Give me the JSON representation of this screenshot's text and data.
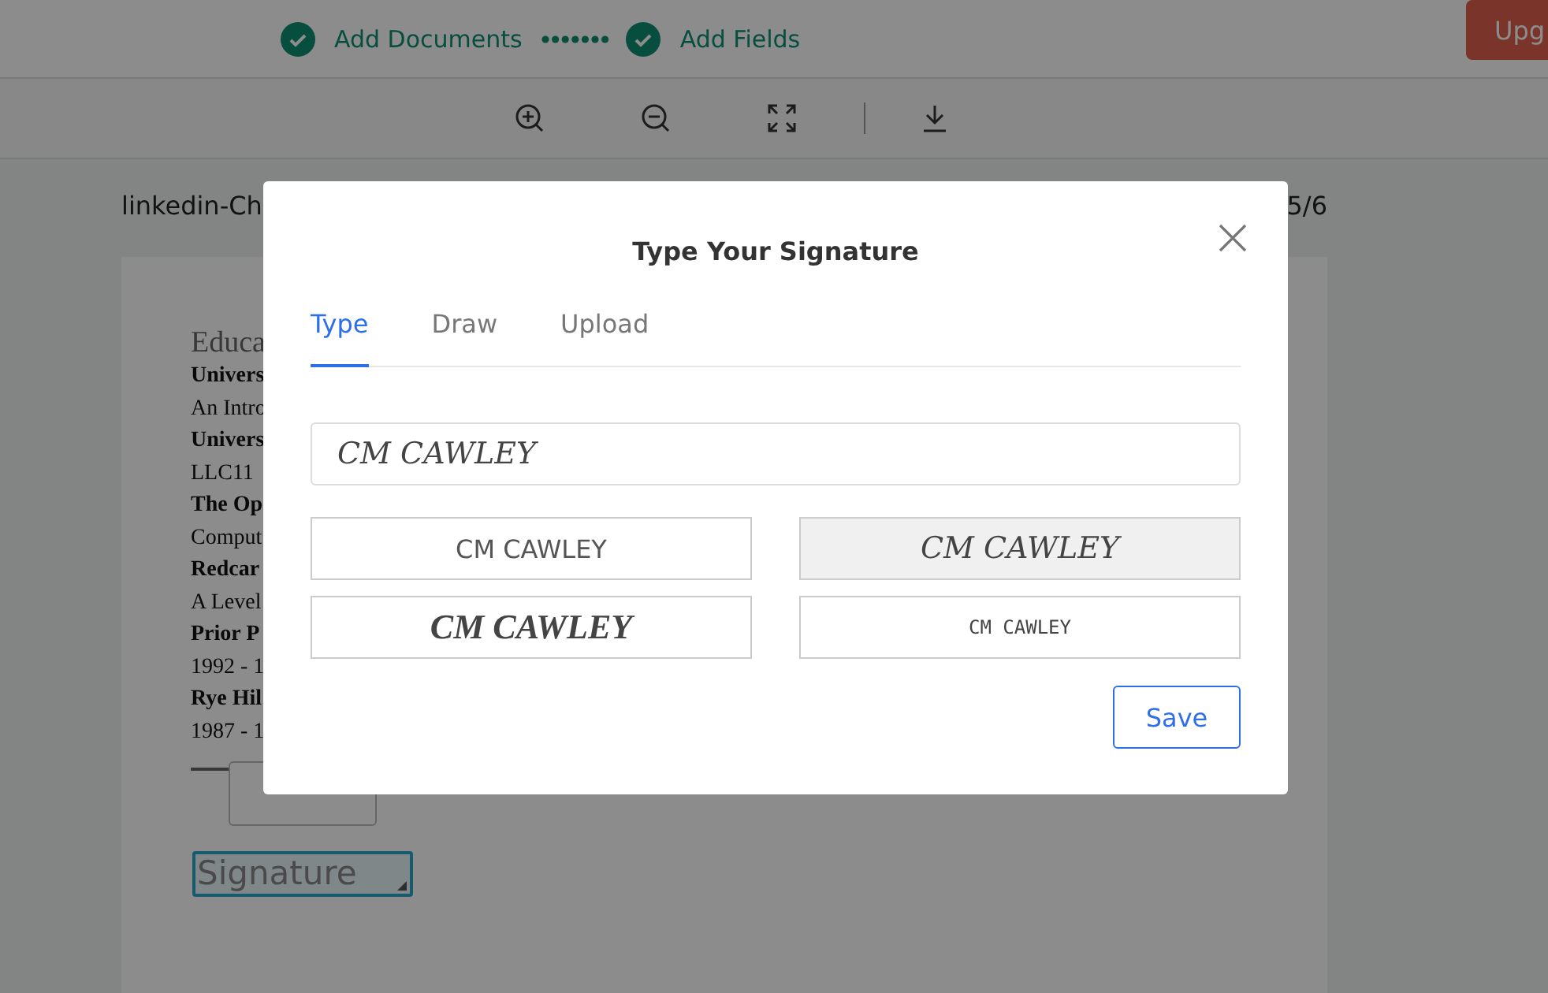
{
  "steps": [
    {
      "label": "Add Documents",
      "done": true
    },
    {
      "label": "Add Fields",
      "done": true
    }
  ],
  "upgrade_button": "Upg",
  "toolbar": [
    {
      "kind": "zoom-in"
    },
    {
      "kind": "zoom-out"
    },
    {
      "kind": "fit"
    },
    {
      "kind": "divider"
    },
    {
      "kind": "download"
    }
  ],
  "document": {
    "name": "linkedin-Ch",
    "page": "5/6",
    "lines": [
      {
        "text": "Educa",
        "kind": "heading"
      },
      {
        "text": "Univers",
        "kind": "bold"
      },
      {
        "text": "An Intro",
        "kind": "plain"
      },
      {
        "text": "Univers",
        "kind": "bold"
      },
      {
        "text": "LLC11",
        "kind": "plain"
      },
      {
        "text": "The Op",
        "kind": "bold"
      },
      {
        "text": "Comput",
        "kind": "plain"
      },
      {
        "text": "Redcar",
        "kind": "bold"
      },
      {
        "text": "A Level",
        "kind": "plain"
      },
      {
        "text": "Prior P",
        "kind": "bold"
      },
      {
        "text": "1992 - 1",
        "kind": "plain"
      },
      {
        "text": "Rye Hil",
        "kind": "bold"
      },
      {
        "text": "1987 - 1",
        "kind": "plain"
      }
    ],
    "field": "Signature"
  },
  "dialog": {
    "title": "Type Your Signature",
    "tabs": [
      {
        "label": "Type",
        "selected": true
      },
      {
        "label": "Draw",
        "selected": false
      },
      {
        "label": "Upload",
        "selected": false
      }
    ],
    "input": {
      "value": "CM CAWLEY"
    },
    "options": [
      {
        "text": "CM CAWLEY",
        "kind": "plain",
        "selected": false
      },
      {
        "text": "CM CAWLEY",
        "kind": "script",
        "selected": true
      },
      {
        "text": "CM CAWLEY",
        "kind": "bold-script",
        "selected": false
      },
      {
        "text": "CM CAWLEY",
        "kind": "hand",
        "selected": false
      }
    ],
    "save_button": "Save"
  }
}
